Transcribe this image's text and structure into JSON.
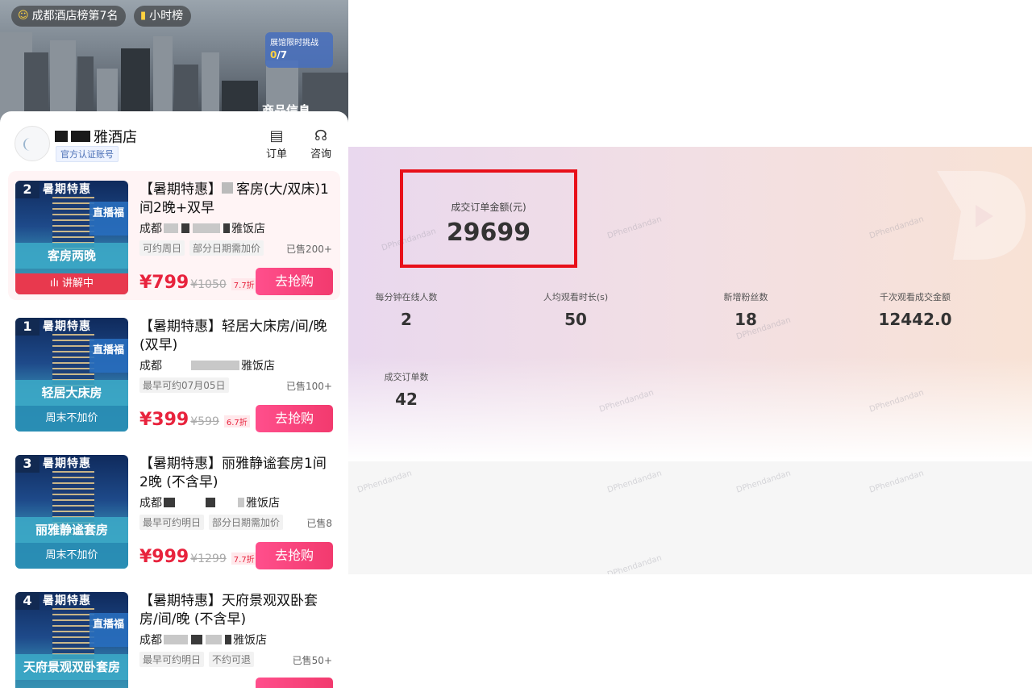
{
  "banner": {
    "rank_pill": "成都酒店榜第7名",
    "hour_pill": "小时榜",
    "expo_title": "展馆限时挑战",
    "expo_done": "0",
    "expo_total": "/7",
    "goods_info": "商品信息"
  },
  "shop": {
    "name_visible": "雅酒店",
    "verified": "官方认证账号",
    "order_label": "订单",
    "consult_label": "咨询"
  },
  "products": [
    {
      "rank": "2",
      "promo": "暑期特惠",
      "live_tag": "直播福",
      "thumb_title": "客房两晚",
      "explaining": "讲解中",
      "title": "【暑期特惠】",
      "title_tail": "客房(大/双床)1间2晚+双早",
      "city": "成都",
      "hotel_suffix": "雅饭店",
      "tags": [
        "可约周日",
        "部分日期需加价"
      ],
      "sold": "已售200+",
      "price": "¥799",
      "old_price": "¥1050",
      "discount": "7.7折",
      "buy": "去抢购"
    },
    {
      "rank": "1",
      "promo": "暑期特惠",
      "live_tag": "直播福",
      "thumb_title": "轻居大床房",
      "thumb_sub": "周末不加价",
      "title": "【暑期特惠】轻居大床房/间/晚(双早)",
      "city": "成都",
      "hotel_suffix": "雅饭店",
      "tags": [
        "最早可约07月05日"
      ],
      "sold": "已售100+",
      "price": "¥399",
      "old_price": "¥599",
      "discount": "6.7折",
      "buy": "去抢购"
    },
    {
      "rank": "3",
      "promo": "暑期特惠",
      "thumb_title": "丽雅静谧套房",
      "thumb_sub": "周末不加价",
      "title": "【暑期特惠】丽雅静谧套房1间2晚 (不含早)",
      "city": "成都",
      "hotel_suffix": "雅饭店",
      "tags": [
        "最早可约明日",
        "部分日期需加价"
      ],
      "sold": "已售8",
      "price": "¥999",
      "old_price": "¥1299",
      "discount": "7.7折",
      "buy": "去抢购"
    },
    {
      "rank": "4",
      "promo": "暑期特惠",
      "live_tag": "直播福",
      "thumb_title": "天府景观双卧套房",
      "title": "【暑期特惠】天府景观双卧套房/间/晚 (不含早)",
      "city": "成都",
      "hotel_suffix": "雅饭店",
      "tags": [
        "最早可约明日",
        "不约可退"
      ],
      "sold": "已售50+"
    }
  ],
  "dashboard": {
    "main_label": "成交订单金额(元)",
    "main_value": "29699",
    "metrics": [
      {
        "label": "每分钟在线人数",
        "value": "2"
      },
      {
        "label": "人均观看时长(s)",
        "value": "50"
      },
      {
        "label": "新增粉丝数",
        "value": "18"
      },
      {
        "label": "千次观看成交金额",
        "value": "12442.0"
      },
      {
        "label": "成交订单数",
        "value": "42"
      }
    ],
    "watermark": "DPhendandan",
    "highlight_color": "#e8101a"
  }
}
